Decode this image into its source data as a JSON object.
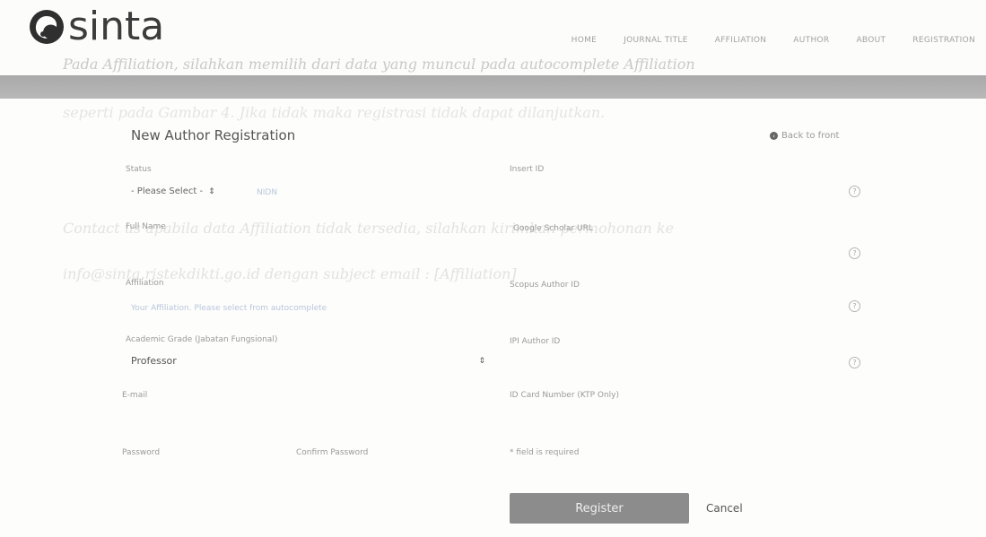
{
  "brand": {
    "name": "sinta"
  },
  "nav": [
    "HOME",
    "JOURNAL TITLE",
    "AFFILIATION",
    "AUTHOR",
    "ABOUT",
    "REGISTRATION"
  ],
  "background_text": [
    "Pada Affiliation, silahkan memilih dari data yang muncul pada autocomplete Affiliation",
    "seperti pada Gambar 4. Jika tidak maka registrasi tidak dapat dilanjutkan.",
    "Contact us apabila data Affiliation tidak tersedia, silahkan kirimkan permohonan ke",
    "info@sinta.ristekdikti.go.id dengan subject email : [Affiliation]"
  ],
  "page": {
    "title": "New Author Registration",
    "back_label": "Back to front"
  },
  "form": {
    "status": {
      "label": "Status",
      "selected": "- Please Select -",
      "hint": "NIDN"
    },
    "nidn": {
      "label": "Insert ID"
    },
    "full_name": {
      "label": "Full Name"
    },
    "google_scholar": {
      "label": "Google Scholar URL"
    },
    "affiliation": {
      "label": "Affiliation",
      "placeholder": "Your Affiliation. Please select from autocomplete"
    },
    "scopus": {
      "label": "Scopus Author ID"
    },
    "academic_grade": {
      "label": "Academic Grade (Jabatan Fungsional)",
      "selected": "Professor"
    },
    "ipi": {
      "label": "IPI Author ID"
    },
    "email": {
      "label": "E-mail"
    },
    "id_card": {
      "label": "ID Card Number (KTP Only)"
    },
    "password": {
      "label": "Password"
    },
    "confirm_password": {
      "label": "Confirm Password"
    },
    "required_note": "* field is required"
  },
  "actions": {
    "register": "Register",
    "cancel": "Cancel"
  },
  "help_glyph": "?",
  "select_arrow": "⇕"
}
